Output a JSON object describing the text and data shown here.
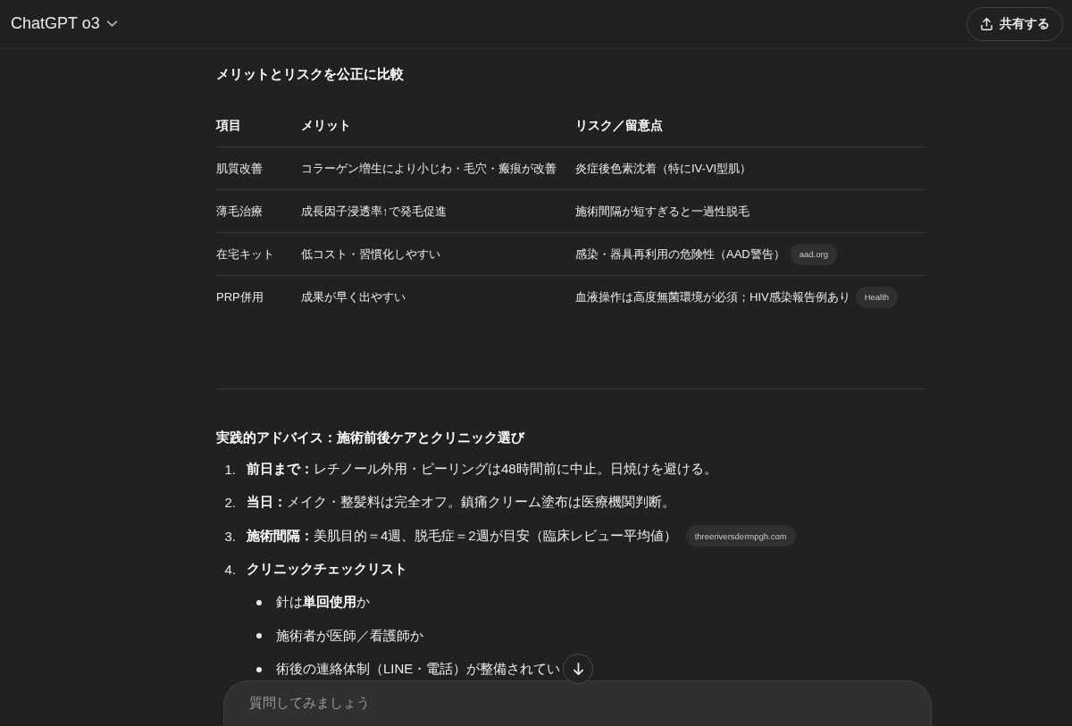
{
  "header": {
    "model_title": "ChatGPT o3",
    "share_button": "共有する"
  },
  "comparison": {
    "heading": "メリットとリスクを公正に比較",
    "table": {
      "columns": [
        "項目",
        "メリット",
        "リスク／留意点"
      ],
      "rows": [
        {
          "item": "肌質改善",
          "merit": "コラーゲン増生により小じわ・毛穴・瘢痕が改善",
          "risk": "炎症後色素沈着（特にIV-VI型肌）"
        },
        {
          "item": "薄毛治療",
          "merit": "成長因子浸透率↑で発毛促進",
          "risk": "施術間隔が短すぎると一過性脱毛"
        },
        {
          "item": "在宅キット",
          "merit": "低コスト・習慣化しやすい",
          "risk": "感染・器具再利用の危険性（AAD警告）",
          "source": "aad.org"
        },
        {
          "item": "PRP併用",
          "merit": "成果が早く出やすい",
          "risk": "血液操作は高度無菌環境が必須；HIV感染報告例あり",
          "source": "Health"
        }
      ]
    }
  },
  "advice": {
    "heading": "実践的アドバイス：施術前後ケアとクリニック選び",
    "steps": [
      {
        "number": "1.",
        "text": "**前日まで：**レチノール外用・ピーリングは48時間前に中止。日焼けを避ける。"
      },
      {
        "number": "2.",
        "text": "**当日：**メイク・整髪料は完全オフ。鎮痛クリーム塗布は医療機関判断。"
      },
      {
        "number": "3.",
        "text": "**施術間隔：**美肌目的＝4週、脱毛症＝2週が目安（臨床レビュー平均値）",
        "source": "threeriversdermpgh.com"
      },
      {
        "number": "4.",
        "text": "クリニックチェックリスト",
        "children": [
          {
            "text": "針は**単回使用**か"
          },
          {
            "text": "施術者が医師／看護師か"
          },
          {
            "text": "術後の連絡体制（LINE・電話）が整備されてい"
          }
        ]
      }
    ]
  },
  "composer": {
    "placeholder": "質問してみましょう"
  }
}
